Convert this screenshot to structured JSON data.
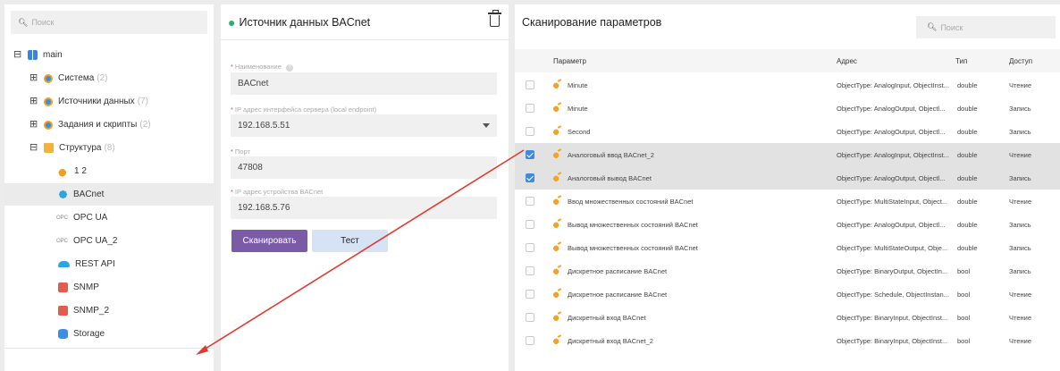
{
  "left_panel": {
    "search_placeholder": "Поиск",
    "root": {
      "label": "main",
      "toggle": "⊟"
    },
    "items": [
      {
        "label": "Система",
        "count": "(2)",
        "toggle": "⊞"
      },
      {
        "label": "Источники данных",
        "count": "(7)",
        "toggle": "⊞"
      },
      {
        "label": "Задания и скрипты",
        "count": "(2)",
        "toggle": "⊞"
      },
      {
        "label": "Структура",
        "count": "(8)",
        "toggle": "⊟"
      }
    ],
    "children": [
      {
        "label": "1 2",
        "icon": "plug-icon"
      },
      {
        "label": "BACnet",
        "icon": "globe-icon"
      },
      {
        "label": "OPC UA",
        "icon": "opc-icon",
        "icon_text": "OPC"
      },
      {
        "label": "OPC UA_2",
        "icon": "opc-icon",
        "icon_text": "OPC"
      },
      {
        "label": "REST API",
        "icon": "cloud-icon"
      },
      {
        "label": "SNMP",
        "icon": "snmp-icon"
      },
      {
        "label": "SNMP_2",
        "icon": "snmp-icon"
      },
      {
        "label": "Storage",
        "icon": "database-icon"
      }
    ]
  },
  "form": {
    "title": "Источник данных BACnet",
    "fields": [
      {
        "label": "Наименование",
        "value": "BACnet"
      },
      {
        "label": "IP адрес интерфейса сервера (local endpoint)",
        "value": "192.168.5.51"
      },
      {
        "label": "Порт",
        "value": "47808"
      },
      {
        "label": "IP адрес устройства BACnet",
        "value": "192.168.5.76"
      }
    ],
    "scan_button": "Сканировать",
    "test_button": "Тест"
  },
  "scan": {
    "title": "Сканирование параметров",
    "search_placeholder": "Поиск",
    "columns": {
      "param": "Параметр",
      "address": "Адрес",
      "type": "Тип",
      "access": "Доступ"
    },
    "rows": [
      {
        "param": "Minute",
        "address": "ObjectType: AnalogInput, ObjectInst...",
        "type": "double",
        "access": "Чтение",
        "checked": false
      },
      {
        "param": "Minute",
        "address": "ObjectType: AnalogOutput, Objectl...",
        "type": "double",
        "access": "Запись",
        "checked": false
      },
      {
        "param": "Second",
        "address": "ObjectType: AnalogOutput, Objectl...",
        "type": "double",
        "access": "Запись",
        "checked": false
      },
      {
        "param": "Аналоговый ввод BACnet_2",
        "address": "ObjectType: AnalogInput, ObjectInst...",
        "type": "double",
        "access": "Чтение",
        "checked": true
      },
      {
        "param": "Аналоговый вывод BACnet",
        "address": "ObjectType: AnalogOutput, Objectl...",
        "type": "double",
        "access": "Запись",
        "checked": true
      },
      {
        "param": "Ввод множественных состояний BACnet",
        "address": "ObjectType: MultiStateInput, Object...",
        "type": "double",
        "access": "Чтение",
        "checked": false
      },
      {
        "param": "Вывод множественных состояний BACnet",
        "address": "ObjectType: AnalogOutput, Objectl...",
        "type": "double",
        "access": "Запись",
        "checked": false
      },
      {
        "param": "Вывод множественных состояний BACnet",
        "address": "ObjectType: MultiStateOutput, Obje...",
        "type": "double",
        "access": "Запись",
        "checked": false
      },
      {
        "param": "Дискретное расписание BACnet",
        "address": "ObjectType: BinaryOutput, ObjectIn...",
        "type": "bool",
        "access": "Запись",
        "checked": false
      },
      {
        "param": "Дискретное расписание BACnet",
        "address": "ObjectType: Schedule, ObjectInstan...",
        "type": "bool",
        "access": "Чтение",
        "checked": false
      },
      {
        "param": "Дискретный вход BACnet",
        "address": "ObjectType: BinaryInput, ObjectInst...",
        "type": "bool",
        "access": "Чтение",
        "checked": false
      },
      {
        "param": "Дискретный вход BACnet_2",
        "address": "ObjectType: BinaryInput, ObjectInst...",
        "type": "bool",
        "access": "Чтение",
        "checked": false
      }
    ]
  },
  "colors": {
    "accent_purple": "#7b5ba8",
    "accent_light_blue": "#d5e3f5",
    "status_green": "#23b26d",
    "checkbox_blue": "#3e8be0",
    "arrow_red": "#e03a30",
    "required_red": "#e14b4b"
  }
}
